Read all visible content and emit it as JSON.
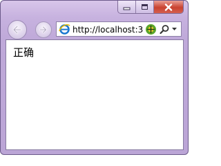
{
  "browser": {
    "address_bar": {
      "url": "http://localhost:3"
    }
  },
  "page": {
    "text": "正确"
  },
  "icons": {
    "back": "back-arrow-icon",
    "forward": "forward-arrow-icon",
    "page": "internet-explorer-icon",
    "compatibility": "compatibility-view-icon",
    "search": "search-icon",
    "dropdown": "chevron-down-icon",
    "minimize": "minimize-icon",
    "maximize": "maximize-icon",
    "close": "close-icon"
  }
}
